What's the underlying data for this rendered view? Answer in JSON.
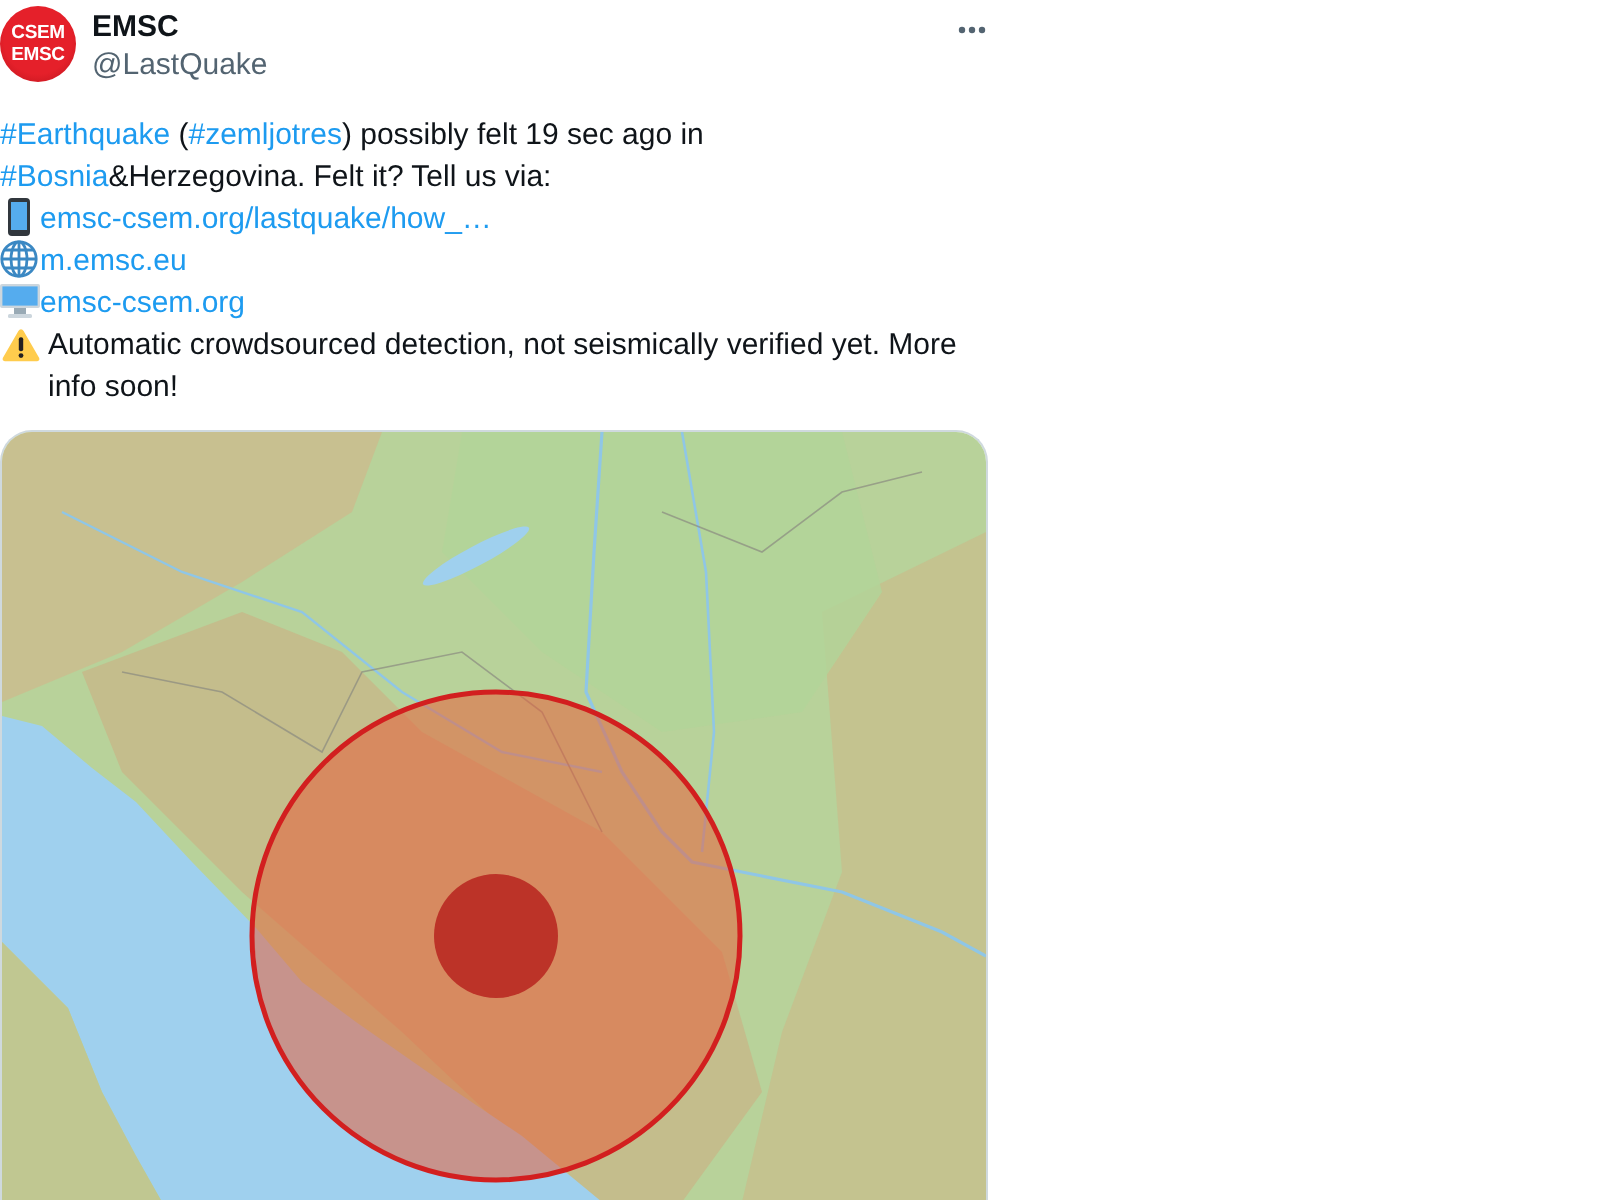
{
  "tweet": {
    "avatar": {
      "lines": [
        "CSEM",
        "EMSC"
      ]
    },
    "name": "EMSC",
    "handle": "@LastQuake",
    "body": [
      {
        "kind": "text",
        "segments": [
          {
            "kind": "hashtag",
            "text": "#Earthquake"
          },
          {
            "kind": "text",
            "text": " ("
          },
          {
            "kind": "hashtag",
            "text": "#zemljotres"
          },
          {
            "kind": "text",
            "text": ") possibly felt 19 sec ago in "
          },
          {
            "kind": "hashtag",
            "text": "#Bosnia"
          },
          {
            "kind": "text",
            "text": "&Herzegovina. Felt it? Tell us via:"
          }
        ]
      },
      {
        "kind": "phone",
        "segments": [
          {
            "kind": "url",
            "text": "emsc-csem.org/lastquake/how_…"
          }
        ]
      },
      {
        "kind": "globe",
        "segments": [
          {
            "kind": "url",
            "text": "m.emsc.eu"
          }
        ]
      },
      {
        "kind": "computer",
        "segments": [
          {
            "kind": "url",
            "text": "emsc-csem.org"
          }
        ]
      },
      {
        "kind": "warning",
        "segments": [
          {
            "kind": "text",
            "text": "Automatic crowdsourced detection, not seismically verified yet. More info soon!"
          }
        ]
      }
    ]
  }
}
